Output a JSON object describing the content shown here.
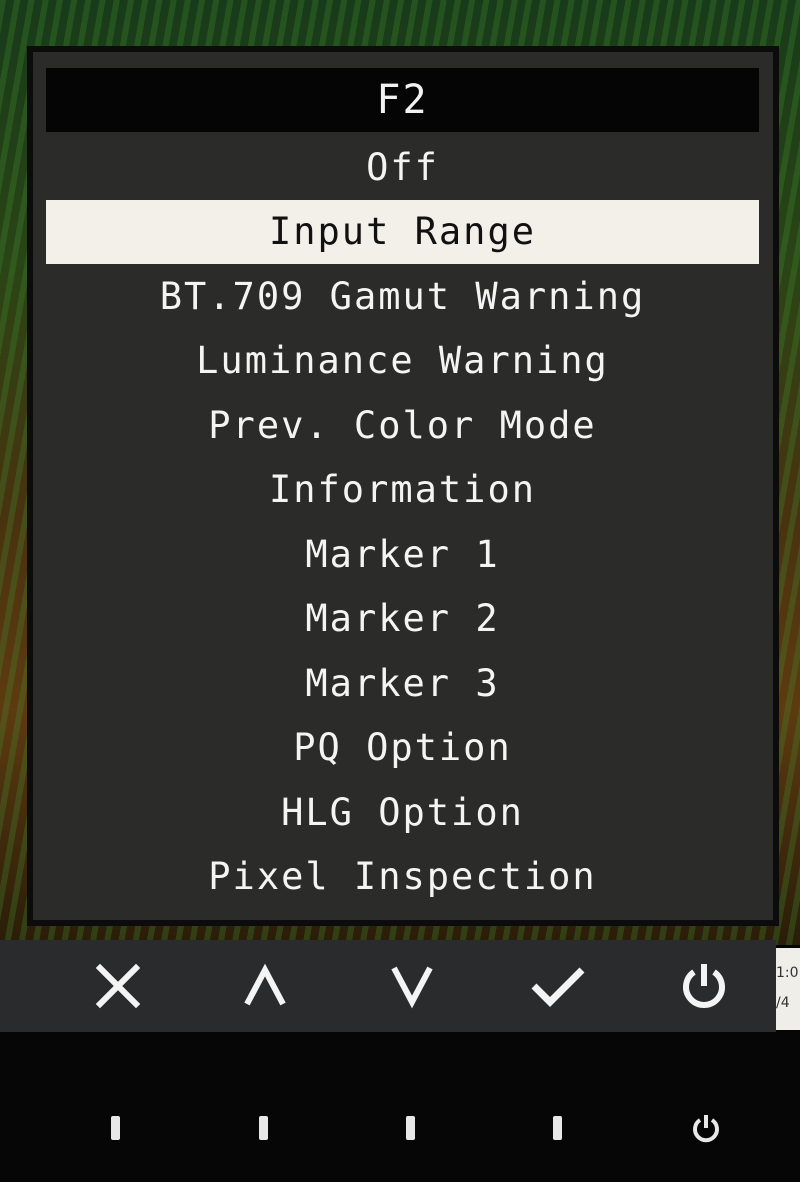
{
  "osd": {
    "title": "F2",
    "items": [
      {
        "label": "Off",
        "selected": false
      },
      {
        "label": "Input Range",
        "selected": true
      },
      {
        "label": "BT.709 Gamut Warning",
        "selected": false
      },
      {
        "label": "Luminance Warning",
        "selected": false
      },
      {
        "label": "Prev. Color Mode",
        "selected": false
      },
      {
        "label": "Information",
        "selected": false
      },
      {
        "label": "Marker 1",
        "selected": false
      },
      {
        "label": "Marker 2",
        "selected": false
      },
      {
        "label": "Marker 3",
        "selected": false
      },
      {
        "label": "PQ Option",
        "selected": false
      },
      {
        "label": "HLG Option",
        "selected": false
      },
      {
        "label": "Pixel Inspection",
        "selected": false
      }
    ]
  },
  "buttons": [
    {
      "icon": "close-icon",
      "action": "cancel"
    },
    {
      "icon": "chevron-up-icon",
      "action": "up"
    },
    {
      "icon": "chevron-down-icon",
      "action": "down"
    },
    {
      "icon": "checkmark-icon",
      "action": "confirm"
    },
    {
      "icon": "power-icon",
      "action": "power"
    }
  ],
  "edge_tab": {
    "line1": "1:0",
    "line2": "/4"
  },
  "colors": {
    "osd_bg": "#2b2c2a",
    "title_bg": "#050505",
    "selected_bg": "#f3f0ea",
    "text": "#f4f4f4"
  }
}
